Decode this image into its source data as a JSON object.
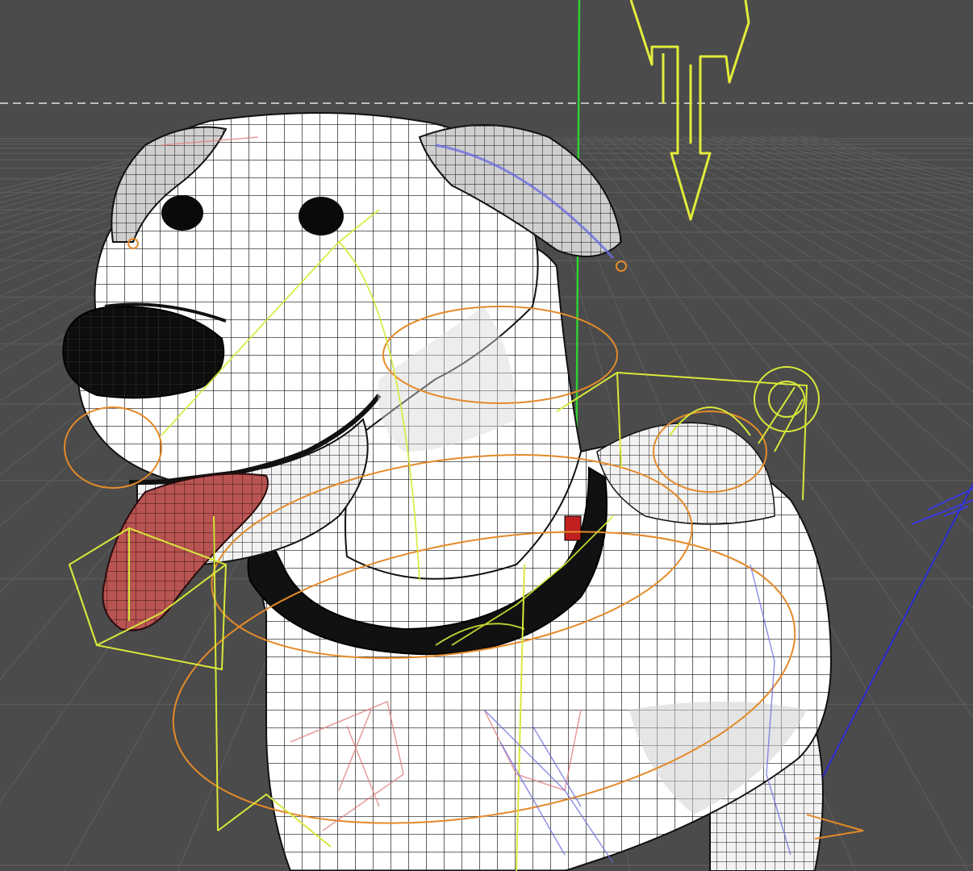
{
  "viewport": {
    "view": "perspective",
    "background_color": "#4b4b4b",
    "floor_grid_color": "#5c5c5c",
    "horizon_line_color": "#bdbdbd",
    "y_axis_color": "#2fd12f",
    "z_axis_color": "#2b2bd6"
  },
  "model": {
    "object": "cartoon-dog",
    "mesh_display": "wireframe-shaded",
    "body_color": "#ffffff",
    "wire_color": "#111111",
    "nose_color": "#111111",
    "collar_color": "#111111",
    "tongue_color": "#b85452"
  },
  "rig": {
    "joint_color": "#d8e83a",
    "control_circle_color": "#e48a2a",
    "left_bone_color": "#e07a7a",
    "right_bone_color": "#6d6de0",
    "move_gizmo": "down-arrow"
  }
}
